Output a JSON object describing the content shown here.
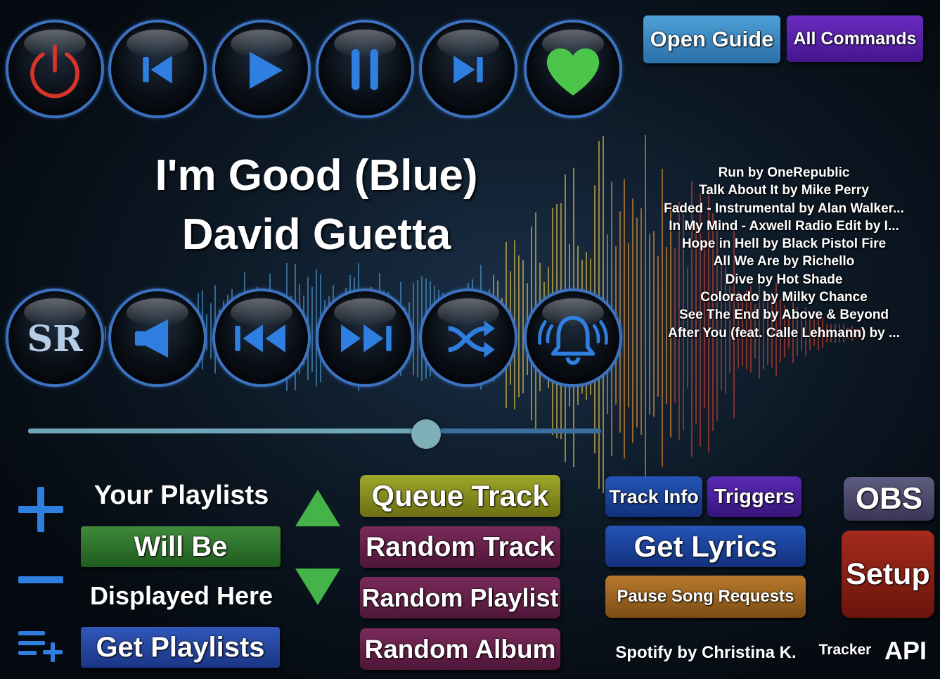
{
  "transport": {
    "top": [
      {
        "name": "power-button",
        "icon": "power-icon"
      },
      {
        "name": "previous-button",
        "icon": "skip-back-icon"
      },
      {
        "name": "play-button",
        "icon": "play-icon"
      },
      {
        "name": "pause-button",
        "icon": "pause-icon"
      },
      {
        "name": "next-button",
        "icon": "skip-forward-icon"
      },
      {
        "name": "like-button",
        "icon": "heart-icon"
      }
    ],
    "bottom": [
      {
        "name": "song-requests-button",
        "icon": "sr-icon",
        "label": "SR"
      },
      {
        "name": "volume-button",
        "icon": "speaker-icon"
      },
      {
        "name": "rewind-button",
        "icon": "rewind-icon"
      },
      {
        "name": "fast-forward-button",
        "icon": "fast-forward-icon"
      },
      {
        "name": "shuffle-button",
        "icon": "shuffle-icon"
      },
      {
        "name": "notify-button",
        "icon": "bell-icon"
      }
    ]
  },
  "header": {
    "open_guide": "Open Guide",
    "all_commands": "All Commands"
  },
  "now_playing": {
    "track": "I'm Good (Blue)",
    "artist": "David Guetta"
  },
  "queue": [
    "Run by OneRepublic",
    "Talk About It by Mike Perry",
    "Faded - Instrumental by Alan Walker...",
    "In My Mind - Axwell Radio Edit by I...",
    "Hope in Hell by Black Pistol Fire",
    "All We Are by Richello",
    "Dive by Hot Shade",
    "Colorado by Milky Chance",
    "See The End by Above & Beyond",
    "After You (feat. Calle Lehmann) by ..."
  ],
  "progress": {
    "fraction": 0.695
  },
  "playlists": {
    "line1": "Your Playlists",
    "line2": "Will Be",
    "line3": "Displayed Here",
    "get_playlists": "Get Playlists"
  },
  "actions": {
    "queue_track": "Queue Track",
    "random_track": "Random Track",
    "random_playlist": "Random Playlist",
    "random_album": "Random Album",
    "track_info": "Track Info",
    "triggers": "Triggers",
    "get_lyrics": "Get Lyrics",
    "pause_song_requests": "Pause Song Requests",
    "obs": "OBS",
    "setup": "Setup"
  },
  "footer": {
    "credit": "Spotify by Christina K.",
    "tracker": "Tracker",
    "api": "API"
  },
  "colors": {
    "icon_blue": "#2f7fe0",
    "power_red": "#d8352a",
    "heart_green": "#4bc64b",
    "ring_blue": "#3c72c0"
  }
}
